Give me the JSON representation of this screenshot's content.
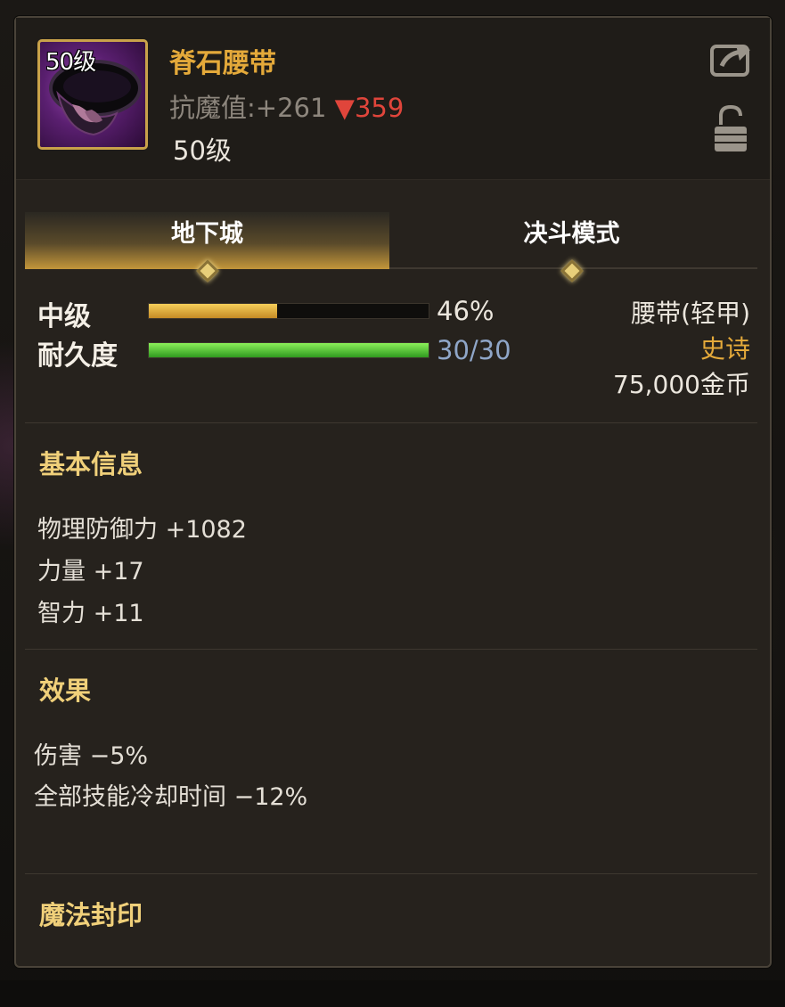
{
  "item": {
    "icon_level": "50级",
    "name": "脊石腰带",
    "stat_label": "抗魔值:",
    "stat_value": "+261",
    "stat_diff_arrow": "▼",
    "stat_diff": "359",
    "level": "50级"
  },
  "header_icons": [
    "share-icon",
    "lock-icon"
  ],
  "tabs": [
    {
      "label": "地下城",
      "active": true
    },
    {
      "label": "决斗模式",
      "active": false
    }
  ],
  "bars": {
    "grade": {
      "label": "中级",
      "value": "46%",
      "fraction": 0.46
    },
    "durability": {
      "label": "耐久度",
      "value": "30/30",
      "fraction": 1.0
    }
  },
  "meta": {
    "type": "腰带(轻甲)",
    "rarity": "史诗",
    "price": "75,000金币"
  },
  "sections": {
    "basic_title": "基本信息",
    "basic_lines": [
      "物理防御力 +1082",
      "力量 +17",
      "智力 +11"
    ],
    "effect_title": "效果",
    "effect_lines": [
      "伤害 −5%",
      "全部技能冷却时间 −12%"
    ],
    "seal_title": "魔法封印"
  },
  "colors": {
    "gold_text": "#e4a93a",
    "rarity_epic": "#e4a93a",
    "down_red": "#e0453b",
    "durability_text": "#8fa6c8",
    "section_title": "#f0d07a"
  }
}
